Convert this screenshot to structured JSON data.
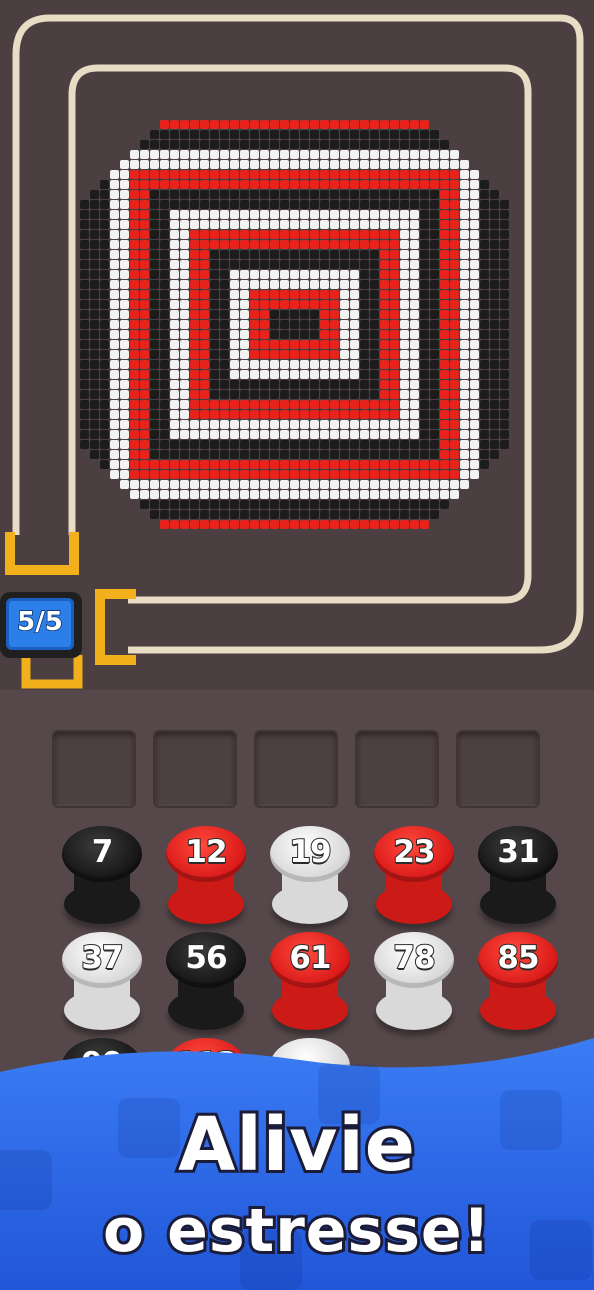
{
  "counter": {
    "text": "5/5"
  },
  "spools": [
    {
      "number": "7",
      "color": "black"
    },
    {
      "number": "12",
      "color": "red"
    },
    {
      "number": "19",
      "color": "white"
    },
    {
      "number": "23",
      "color": "red"
    },
    {
      "number": "31",
      "color": "black"
    },
    {
      "number": "37",
      "color": "white"
    },
    {
      "number": "56",
      "color": "black"
    },
    {
      "number": "61",
      "color": "red"
    },
    {
      "number": "78",
      "color": "white"
    },
    {
      "number": "85",
      "color": "red"
    },
    {
      "number": "99",
      "color": "black"
    },
    {
      "number": "113",
      "color": "red"
    },
    {
      "number": "",
      "color": "white"
    }
  ],
  "banner": {
    "line1": "Alivie",
    "line2": "o estresse!"
  },
  "colors": {
    "red": "#e8231c",
    "black": "#1c1c1c",
    "white": "#f2f2f2",
    "banner": "#2f6ff0"
  }
}
